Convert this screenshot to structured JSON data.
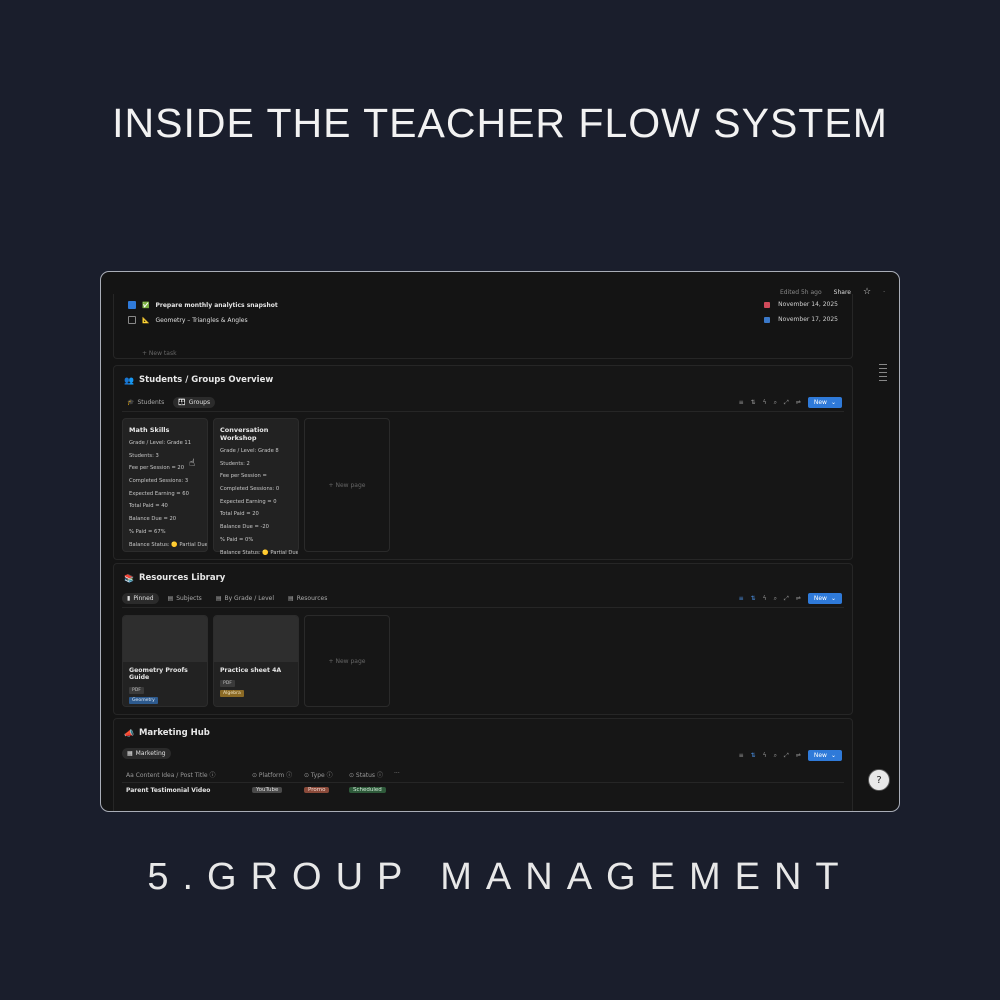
{
  "headline": "INSIDE THE TEACHER FLOW SYSTEM",
  "subline": "5.GROUP MANAGEMENT",
  "topbar": {
    "edited": "Edited 5h ago",
    "share": "Share",
    "star_icon": "star-icon",
    "more_icon": "more-icon"
  },
  "tasks": {
    "rows": [
      {
        "label": "Prepare monthly analytics snapshot",
        "date": "November 14, 2025",
        "checked": true
      },
      {
        "label": "Geometry – Triangles & Angles",
        "date": "November 17, 2025",
        "checked": false
      }
    ],
    "new_task": "+ New task"
  },
  "students": {
    "title": "Students / Groups Overview",
    "tabs": [
      "Students",
      "Groups"
    ],
    "new_label": "New",
    "cards": [
      {
        "title": "Math Skills",
        "props": [
          "Grade / Level: Grade 11",
          "Students: 3",
          "Fee per Session = 20",
          "Completed Sessions: 3",
          "Expected Earning = 60",
          "Total Paid = 40",
          "Balance Due = 20",
          "% Paid = 67%",
          "Balance Status: 🟡 Partial Due"
        ]
      },
      {
        "title": "Conversation Workshop",
        "props": [
          "Grade / Level: Grade 8",
          "Students: 2",
          "Fee per Session =",
          "Completed Sessions: 0",
          "Expected Earning = 0",
          "Total Paid = 20",
          "Balance Due = -20",
          "% Paid = 0%",
          "Balance Status: 🟡 Partial Due"
        ]
      }
    ],
    "new_page": "+ New page"
  },
  "resources": {
    "title": "Resources Library",
    "tabs": [
      "Pinned",
      "Subjects",
      "By Grade / Level",
      "Resources"
    ],
    "new_label": "New",
    "cards": [
      {
        "title": "Geometry Proofs Guide",
        "type": "PDF",
        "subject": "Geometry"
      },
      {
        "title": "Practice sheet 4A",
        "type": "PDF",
        "subject": "Algebra"
      }
    ],
    "new_page": "+ New page"
  },
  "marketing": {
    "title": "Marketing Hub",
    "tab": "Marketing",
    "new_label": "New",
    "columns": [
      "Aa Content Idea / Post Title ⓘ",
      "⊙ Platform ⓘ",
      "⊙ Type ⓘ",
      "⊙ Status ⓘ",
      "···"
    ],
    "rows": [
      {
        "title": "Parent Testimonial Video",
        "platform": "YouTube",
        "type": "Promo",
        "status": "Scheduled"
      }
    ]
  },
  "colors": {
    "background": "#1a1e2c",
    "accent": "#2f7ad9",
    "frame_border": "#a9adb7"
  }
}
